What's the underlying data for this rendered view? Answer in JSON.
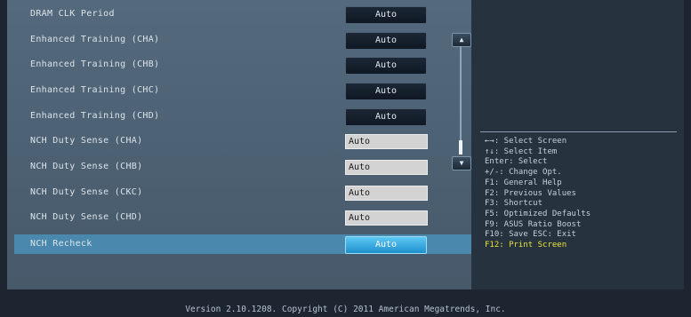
{
  "settings": [
    {
      "label": "DRAM CLK Period",
      "value": "Auto",
      "control": "button"
    },
    {
      "label": "Enhanced Training (CHA)",
      "value": "Auto",
      "control": "button"
    },
    {
      "label": "Enhanced Training (CHB)",
      "value": "Auto",
      "control": "button"
    },
    {
      "label": "Enhanced Training (CHC)",
      "value": "Auto",
      "control": "button"
    },
    {
      "label": "Enhanced Training (CHD)",
      "value": "Auto",
      "control": "button"
    },
    {
      "label": "NCH Duty Sense (CHA)",
      "value": "Auto",
      "control": "input"
    },
    {
      "label": "NCH Duty Sense (CHB)",
      "value": "Auto",
      "control": "input"
    },
    {
      "label": "NCH Duty Sense (CKC)",
      "value": "Auto",
      "control": "input"
    },
    {
      "label": "NCH Duty Sense (CHD)",
      "value": "Auto",
      "control": "input"
    },
    {
      "label": "NCH Recheck",
      "value": "Auto",
      "control": "button-highlight"
    }
  ],
  "scrollbar": {
    "up_icon": "triangle-up",
    "down_icon": "triangle-down"
  },
  "help": {
    "lines": [
      "←→: Select Screen",
      "↑↓: Select Item",
      "Enter: Select",
      "+/-: Change Opt.",
      "F1: General Help",
      "F2: Previous Values",
      "F3: Shortcut",
      "F5: Optimized Defaults",
      "F9: ASUS Ratio Boost",
      "F10: Save  ESC: Exit",
      "F12: Print Screen"
    ],
    "highlight_color": "#e9e43c"
  },
  "footer": {
    "text": "Version 2.10.1208. Copyright (C) 2011 American Megatrends, Inc."
  }
}
